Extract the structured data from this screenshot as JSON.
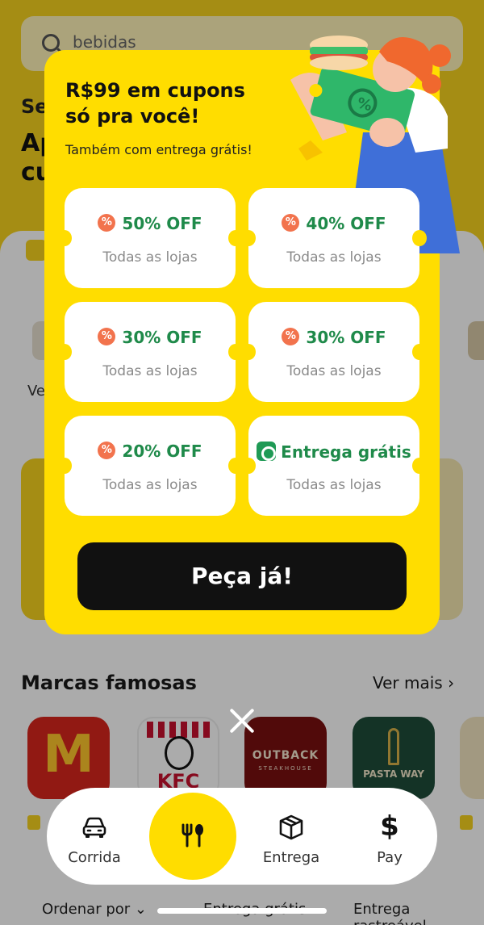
{
  "background": {
    "search_placeholder": "bebidas",
    "heading_partial_1": "Se",
    "heading_partial_2": "Ap cu",
    "category_partial": "Ve",
    "section_title": "Marcas famosas",
    "see_more": "Ver mais ›",
    "brands": [
      {
        "name": "McDonald's",
        "logo_text": "M"
      },
      {
        "name": "KFC",
        "logo_text": "KFC"
      },
      {
        "name": "Outback",
        "logo_text": "OUTBACK",
        "logo_sub": "STEAKHOUSE"
      },
      {
        "name": "Pasta Way",
        "logo_text": "PASTA WAY"
      }
    ],
    "filters": [
      "Ordenar por ⌄",
      "Entrega grátis",
      "Entrega rastreável"
    ]
  },
  "modal": {
    "title": "R$99 em cupons\nsó pra você!",
    "subtitle": "Também com entrega grátis!",
    "coupons": [
      {
        "label": "50% OFF",
        "detail": "Todas as lojas",
        "icon": "percent-badge-icon"
      },
      {
        "label": "40% OFF",
        "detail": "Todas as lojas",
        "icon": "percent-badge-icon"
      },
      {
        "label": "30% OFF",
        "detail": "Todas as lojas",
        "icon": "percent-badge-icon"
      },
      {
        "label": "30% OFF",
        "detail": "Todas as lojas",
        "icon": "percent-badge-icon"
      },
      {
        "label": "20% OFF",
        "detail": "Todas as lojas",
        "icon": "percent-badge-icon"
      },
      {
        "label": "Entrega grátis",
        "detail": "Todas as lojas",
        "icon": "delivery-badge-icon"
      }
    ],
    "cta_label": "Peça já!"
  },
  "bottom_nav": {
    "items": [
      {
        "label": "Corrida",
        "icon": "car-icon"
      },
      {
        "label": "",
        "icon": "fork-spoon-icon",
        "active": true
      },
      {
        "label": "Entrega",
        "icon": "package-icon"
      },
      {
        "label": "Pay",
        "icon": "dollar-icon",
        "symbol": "$"
      }
    ]
  },
  "colors": {
    "brand_yellow": "#ffdd00",
    "coupon_green": "#1f8a4a",
    "badge_orange": "#f2734d",
    "cta_black": "#111111"
  }
}
